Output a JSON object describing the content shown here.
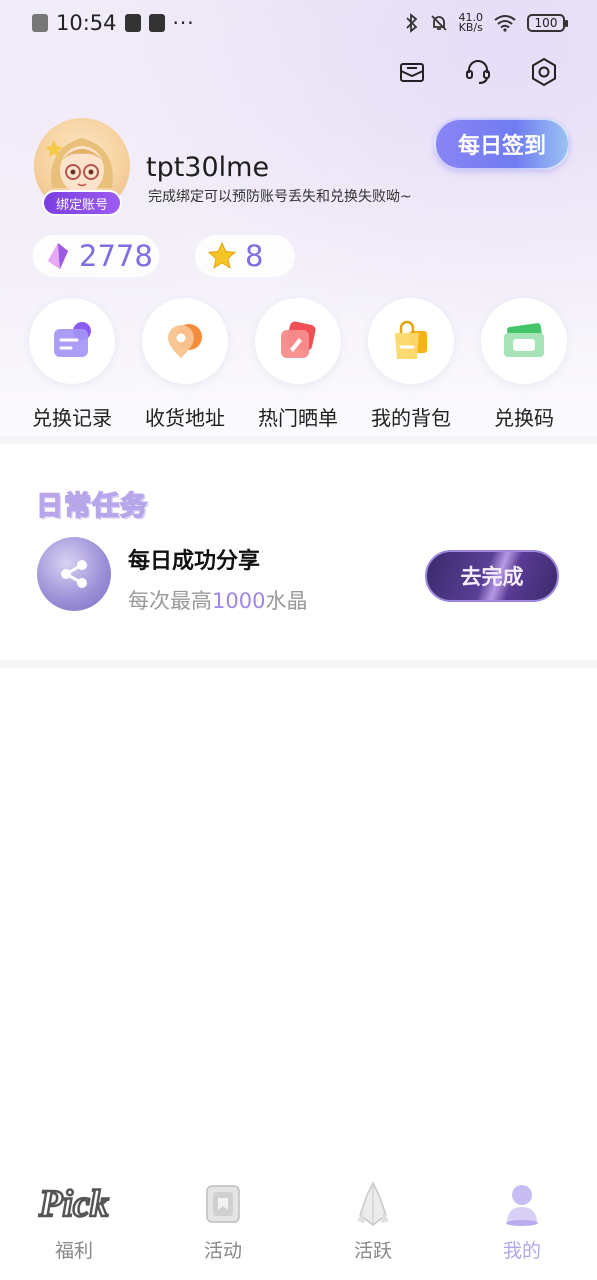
{
  "status_bar": {
    "time": "10:54",
    "dots": "···",
    "net_speed_value": "41.0",
    "net_speed_unit": "KB/s",
    "battery": "100"
  },
  "profile": {
    "username": "tpt30lme",
    "bind_label": "绑定账号",
    "tip": "完成绑定可以预防账号丢失和兑换失败呦~",
    "checkin_label": "每日签到"
  },
  "wallet": {
    "crystals": "2778",
    "stars": "8"
  },
  "shortcuts": [
    {
      "label": "兑换记录",
      "icon": "exchange-record-icon",
      "color": "#8f7cf0"
    },
    {
      "label": "收货地址",
      "icon": "location-pin-icon",
      "color": "#f6a86a"
    },
    {
      "label": "热门晒单",
      "icon": "edit-note-icon",
      "color": "#f06b6b"
    },
    {
      "label": "我的背包",
      "icon": "shopping-bag-icon",
      "color": "#f5c33b"
    },
    {
      "label": "兑换码",
      "icon": "coupon-ticket-icon",
      "color": "#5ccf7a"
    }
  ],
  "daily_tasks": {
    "heading": "日常任务",
    "items": [
      {
        "title": "每日成功分享",
        "desc_prefix": "每次最高",
        "desc_amount": "1000",
        "desc_suffix": "水晶",
        "button": "去完成"
      }
    ]
  },
  "bottom_nav": [
    {
      "label": "福利",
      "logo_text": "Pick",
      "active": false
    },
    {
      "label": "活动",
      "active": false
    },
    {
      "label": "活跃",
      "active": false
    },
    {
      "label": "我的",
      "active": true
    }
  ]
}
